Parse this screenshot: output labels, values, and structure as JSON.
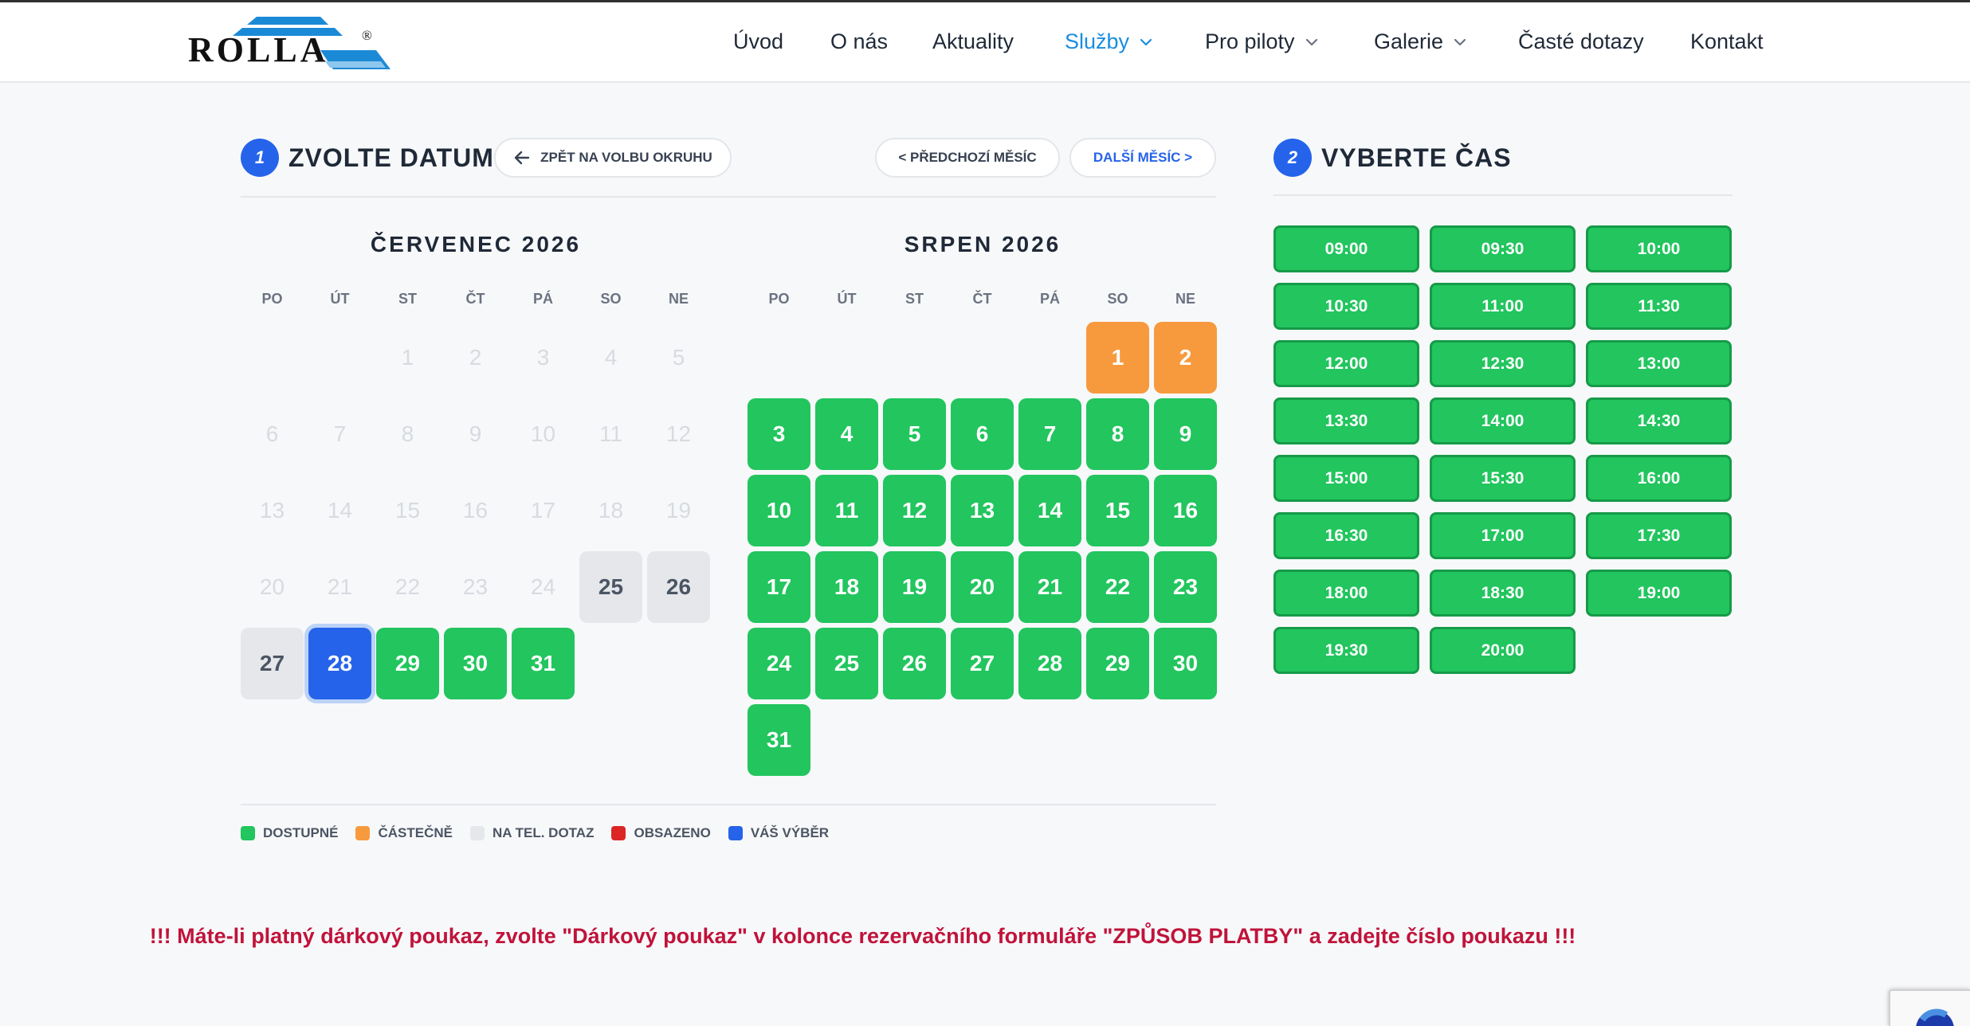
{
  "brand": {
    "logo_text": "ROLLA",
    "reg_mark": "®",
    "accent": "#1a8de0",
    "logo_blue": "#1b8ad6"
  },
  "nav": [
    {
      "label": "Úvod",
      "dropdown": false,
      "active": false
    },
    {
      "label": "O nás",
      "dropdown": false,
      "active": false
    },
    {
      "label": "Aktuality",
      "dropdown": false,
      "active": false
    },
    {
      "label": "Služby",
      "dropdown": true,
      "active": true
    },
    {
      "label": "Pro piloty",
      "dropdown": true,
      "active": false
    },
    {
      "label": "Galerie",
      "dropdown": true,
      "active": false
    },
    {
      "label": "Časté dotazy",
      "dropdown": false,
      "active": false
    },
    {
      "label": "Kontakt",
      "dropdown": false,
      "active": false
    }
  ],
  "date_section": {
    "step": "1",
    "title": "ZVOLTE DATUM",
    "back_label": "ZPĚT NA VOLBU OKRUHU",
    "prev_label": "< PŘEDCHOZÍ MĚSÍC",
    "next_label": "DALŠÍ MĚSÍC >"
  },
  "weekdays": [
    "PO",
    "ÚT",
    "ST",
    "ČT",
    "PÁ",
    "SO",
    "NE"
  ],
  "months": [
    {
      "title": "ČERVENEC 2026",
      "first_weekday": 2,
      "days": [
        {
          "d": "1",
          "s": "past"
        },
        {
          "d": "2",
          "s": "past"
        },
        {
          "d": "3",
          "s": "past"
        },
        {
          "d": "4",
          "s": "past"
        },
        {
          "d": "5",
          "s": "past"
        },
        {
          "d": "6",
          "s": "past"
        },
        {
          "d": "7",
          "s": "past"
        },
        {
          "d": "8",
          "s": "past"
        },
        {
          "d": "9",
          "s": "past"
        },
        {
          "d": "10",
          "s": "past"
        },
        {
          "d": "11",
          "s": "past"
        },
        {
          "d": "12",
          "s": "past"
        },
        {
          "d": "13",
          "s": "past"
        },
        {
          "d": "14",
          "s": "past"
        },
        {
          "d": "15",
          "s": "past"
        },
        {
          "d": "16",
          "s": "past"
        },
        {
          "d": "17",
          "s": "past"
        },
        {
          "d": "18",
          "s": "past"
        },
        {
          "d": "19",
          "s": "past"
        },
        {
          "d": "20",
          "s": "past"
        },
        {
          "d": "21",
          "s": "past"
        },
        {
          "d": "22",
          "s": "past"
        },
        {
          "d": "23",
          "s": "past"
        },
        {
          "d": "24",
          "s": "past"
        },
        {
          "d": "25",
          "s": "phone"
        },
        {
          "d": "26",
          "s": "phone"
        },
        {
          "d": "27",
          "s": "phone"
        },
        {
          "d": "28",
          "s": "selected"
        },
        {
          "d": "29",
          "s": "avail"
        },
        {
          "d": "30",
          "s": "avail"
        },
        {
          "d": "31",
          "s": "avail"
        }
      ]
    },
    {
      "title": "SRPEN 2026",
      "first_weekday": 5,
      "days": [
        {
          "d": "1",
          "s": "partial"
        },
        {
          "d": "2",
          "s": "partial"
        },
        {
          "d": "3",
          "s": "avail"
        },
        {
          "d": "4",
          "s": "avail"
        },
        {
          "d": "5",
          "s": "avail"
        },
        {
          "d": "6",
          "s": "avail"
        },
        {
          "d": "7",
          "s": "avail"
        },
        {
          "d": "8",
          "s": "avail"
        },
        {
          "d": "9",
          "s": "avail"
        },
        {
          "d": "10",
          "s": "avail"
        },
        {
          "d": "11",
          "s": "avail"
        },
        {
          "d": "12",
          "s": "avail"
        },
        {
          "d": "13",
          "s": "avail"
        },
        {
          "d": "14",
          "s": "avail"
        },
        {
          "d": "15",
          "s": "avail"
        },
        {
          "d": "16",
          "s": "avail"
        },
        {
          "d": "17",
          "s": "avail"
        },
        {
          "d": "18",
          "s": "avail"
        },
        {
          "d": "19",
          "s": "avail"
        },
        {
          "d": "20",
          "s": "avail"
        },
        {
          "d": "21",
          "s": "avail"
        },
        {
          "d": "22",
          "s": "avail"
        },
        {
          "d": "23",
          "s": "avail"
        },
        {
          "d": "24",
          "s": "avail"
        },
        {
          "d": "25",
          "s": "avail"
        },
        {
          "d": "26",
          "s": "avail"
        },
        {
          "d": "27",
          "s": "avail"
        },
        {
          "d": "28",
          "s": "avail"
        },
        {
          "d": "29",
          "s": "avail"
        },
        {
          "d": "30",
          "s": "avail"
        },
        {
          "d": "31",
          "s": "avail"
        }
      ]
    }
  ],
  "legend": [
    {
      "label": "DOSTUPNÉ",
      "color": "#22c55e"
    },
    {
      "label": "ČÁSTEČNĚ",
      "color": "#f79a3e"
    },
    {
      "label": "NA TEL. DOTAZ",
      "color": "#e5e7eb"
    },
    {
      "label": "OBSAZENO",
      "color": "#dc2626"
    },
    {
      "label": "VÁŠ VÝBĚR",
      "color": "#2563eb"
    }
  ],
  "time_section": {
    "step": "2",
    "title": "VYBERTE ČAS",
    "slots": [
      "09:00",
      "09:30",
      "10:00",
      "10:30",
      "11:00",
      "11:30",
      "12:00",
      "12:30",
      "13:00",
      "13:30",
      "14:00",
      "14:30",
      "15:00",
      "15:30",
      "16:00",
      "16:30",
      "17:00",
      "17:30",
      "18:00",
      "18:30",
      "19:00",
      "19:30",
      "20:00"
    ]
  },
  "notice": "!!! Máte-li platný dárkový poukaz, zvolte \"Dárkový poukaz\" v kolonce rezervačního formuláře \"ZPŮSOB PLATBY\" a zadejte číslo poukazu !!!"
}
